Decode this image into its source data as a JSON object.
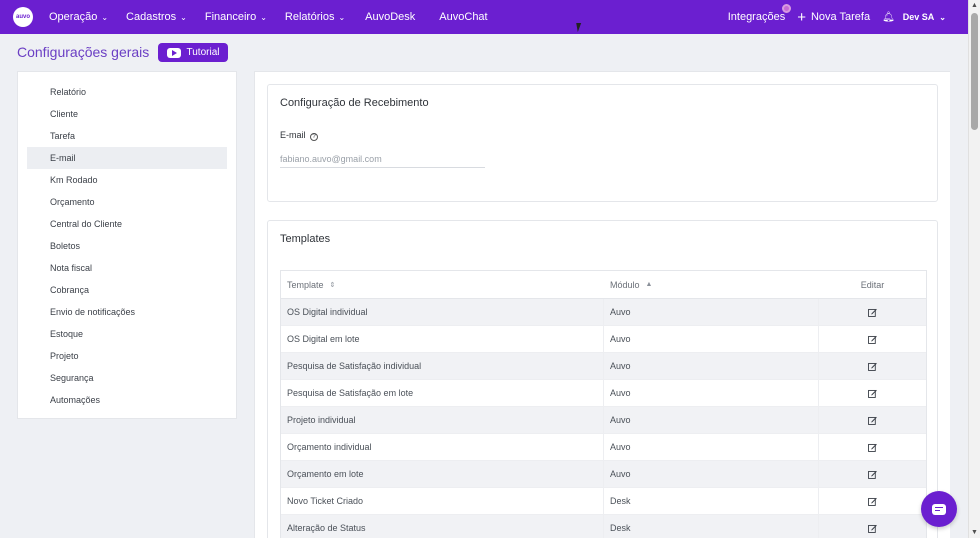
{
  "nav": {
    "logo_text": "auvo",
    "items": [
      {
        "label": "Operação",
        "dropdown": true
      },
      {
        "label": "Cadastros",
        "dropdown": true
      },
      {
        "label": "Financeiro",
        "dropdown": true
      },
      {
        "label": "Relatórios",
        "dropdown": true
      },
      {
        "label": "AuvoDesk",
        "dropdown": false
      },
      {
        "label": "AuvoChat",
        "dropdown": false
      }
    ],
    "integracoes": "Integrações",
    "nova_tarefa": "Nova Tarefa",
    "user": "Dev SA"
  },
  "header": {
    "title": "Configurações gerais",
    "tutorial": "Tutorial"
  },
  "sidebar": {
    "items": [
      {
        "label": "Relatório"
      },
      {
        "label": "Cliente"
      },
      {
        "label": "Tarefa"
      },
      {
        "label": "E-mail",
        "active": true
      },
      {
        "label": "Km Rodado"
      },
      {
        "label": "Orçamento"
      },
      {
        "label": "Central do Cliente"
      },
      {
        "label": "Boletos"
      },
      {
        "label": "Nota fiscal"
      },
      {
        "label": "Cobrança"
      },
      {
        "label": "Envio de notificações"
      },
      {
        "label": "Estoque"
      },
      {
        "label": "Projeto"
      },
      {
        "label": "Segurança"
      },
      {
        "label": "Automações"
      }
    ]
  },
  "recebimento": {
    "title": "Configuração de Recebimento",
    "email_label": "E-mail",
    "email_value": "fabiano.auvo@gmail.com"
  },
  "templates": {
    "title": "Templates",
    "columns": {
      "template": "Template",
      "modulo": "Módulo",
      "editar": "Editar"
    },
    "rows": [
      {
        "template": "OS Digital individual",
        "modulo": "Auvo"
      },
      {
        "template": "OS Digital em lote",
        "modulo": "Auvo"
      },
      {
        "template": "Pesquisa de Satisfação individual",
        "modulo": "Auvo"
      },
      {
        "template": "Pesquisa de Satisfação em lote",
        "modulo": "Auvo"
      },
      {
        "template": "Projeto individual",
        "modulo": "Auvo"
      },
      {
        "template": "Orçamento individual",
        "modulo": "Auvo"
      },
      {
        "template": "Orçamento em lote",
        "modulo": "Auvo"
      },
      {
        "template": "Novo Ticket Criado",
        "modulo": "Desk"
      },
      {
        "template": "Alteração de Status",
        "modulo": "Desk"
      }
    ]
  },
  "colors": {
    "brand": "#6b1fd0",
    "title": "#6b3fc4"
  }
}
